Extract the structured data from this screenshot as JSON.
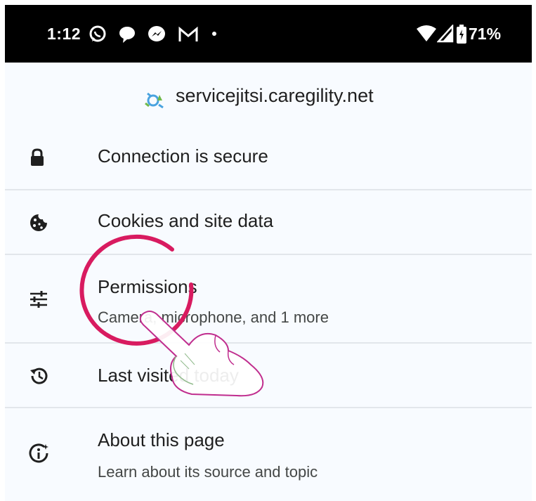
{
  "status_bar": {
    "time": "1:12",
    "battery": "71%",
    "icons": [
      "whatsapp-icon",
      "chat-bubble-icon",
      "messenger-icon",
      "gmail-icon",
      "wifi-icon",
      "signal-icon",
      "battery-icon"
    ]
  },
  "site": {
    "domain": "servicejitsi.caregility.net",
    "icon": "site-favicon-icon"
  },
  "menu": {
    "connection": {
      "title": "Connection is secure",
      "icon": "lock-icon"
    },
    "cookies": {
      "title": "Cookies and site data",
      "icon": "cookie-icon"
    },
    "permissions": {
      "title": "Permissions",
      "subtitle": "Camera, microphone, and 1 more",
      "icon": "tune-sliders-icon"
    },
    "history": {
      "title": "Last visited today",
      "icon": "history-icon"
    },
    "about": {
      "title": "About this page",
      "subtitle": "Learn about its source and topic",
      "icon": "about-page-icon"
    }
  },
  "colors": {
    "status_bar_bg": "#000000",
    "panel_bg": "#f8fbff",
    "divider": "#e2e6eb",
    "annotation_circle": "#d81b60",
    "hand_outline": "#c02d8e",
    "hand_fill": "#ffffff"
  }
}
